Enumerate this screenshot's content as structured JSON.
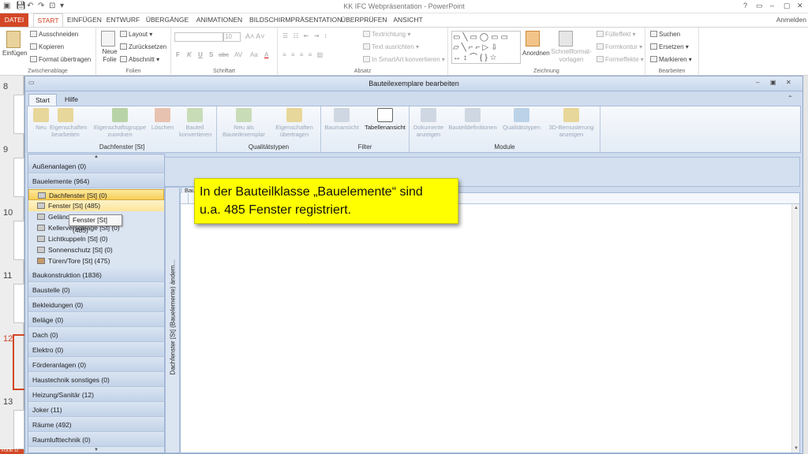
{
  "window": {
    "title": "KK IFC Webpräsentation - PowerPoint",
    "controls": [
      "?",
      "▭",
      "–",
      "▢",
      "✕"
    ],
    "sign_in": "Anmelden"
  },
  "ribbon_tabs": [
    "DATEI",
    "START",
    "EINFÜGEN",
    "ENTWURF",
    "ÜBERGÄNGE",
    "ANIMATIONEN",
    "BILDSCHIRMPRÄSENTATION",
    "ÜBERPRÜFEN",
    "ANSICHT"
  ],
  "ribbon": {
    "clipboard": {
      "label": "Zwischenablage",
      "paste": "Einfügen",
      "cut": "Ausschneiden",
      "copy": "Kopieren",
      "format_painter": "Format übertragen"
    },
    "slides": {
      "label": "Folien",
      "new_slide": "Neue Folie",
      "layout": "Layout",
      "reset": "Zurücksetzen",
      "section": "Abschnitt"
    },
    "font": {
      "label": "Schriftart",
      "size": "10",
      "letters": [
        "F",
        "K",
        "U",
        "S",
        "abc",
        "AV",
        "Aa",
        "A"
      ]
    },
    "paragraph": {
      "label": "Absatz",
      "text_direction": "Textrichtung",
      "align_text": "Text ausrichten",
      "smartart": "In SmartArt konvertieren"
    },
    "drawing": {
      "label": "Zeichnung",
      "arrange": "Anordnen",
      "quick_styles": "Schnellformat-vorlagen",
      "fill": "Fülleffekt",
      "outline": "Formkontur",
      "effects": "Formeffekte"
    },
    "editing": {
      "label": "Bearbeiten",
      "find": "Suchen",
      "replace": "Ersetzen",
      "select": "Markieren"
    }
  },
  "slide_numbers": [
    "8",
    "9",
    "10",
    "11",
    "12",
    "13"
  ],
  "status_bar": "FOLIE 12",
  "dialog": {
    "title": "Bauteilexemplare bearbeiten",
    "tabs": [
      "Start",
      "Hilfe"
    ],
    "groups": [
      {
        "label": "Dachfenster [St]",
        "buttons": [
          "Neu",
          "Eigenschaften bearbeiten",
          "Eigenschaftsgruppe zuordnen",
          "Löschen",
          "Bauteil konvertieren"
        ]
      },
      {
        "label": "Qualitätstypen",
        "buttons": [
          "Neu als Bauteilexemplar",
          "Eigenschaften übertragen"
        ]
      },
      {
        "label": "Filter",
        "buttons": [
          "Baumansicht",
          "Tabellenansicht"
        ]
      },
      {
        "label": "Module",
        "buttons": [
          "Dokumente anzeigen",
          "Bauteildefinitionen",
          "Qualitätstypen",
          "3D-Bemusterung anzeigen"
        ]
      }
    ],
    "tree": {
      "categories_top": [
        "Außenanlagen (0)",
        "Bauelemente (964)"
      ],
      "subitems": [
        "Dachfenster [St] (0)",
        "Fenster [St] (485)",
        "Geländer",
        "Kellerverschläge [St] (0)",
        "Lichtkuppeln [St] (0)",
        "Sonnenschutz [St] (0)",
        "Türen/Tore [St] (475)"
      ],
      "categories_bottom": [
        "Baukonstruktion (1836)",
        "Baustelle (0)",
        "Bekleidungen (0)",
        "Beläge (0)",
        "Dach (0)",
        "Elektro (0)",
        "Förderanlagen (0)",
        "Haustechnik sonstiges (0)",
        "Heizung/Sanitär (12)",
        "Joker (11)",
        "Räume (492)",
        "Raumlufttechnik (0)"
      ]
    },
    "vertical_panel": "Dachfenster [St] (Bauelemente) ändern...",
    "content_tab": "Bau",
    "tooltip": "Fenster [St] (485)"
  },
  "callout": {
    "line1": "In der Bauteilklasse „Bauelemente“ sind",
    "line2": "u.a. 485 Fenster registriert."
  }
}
